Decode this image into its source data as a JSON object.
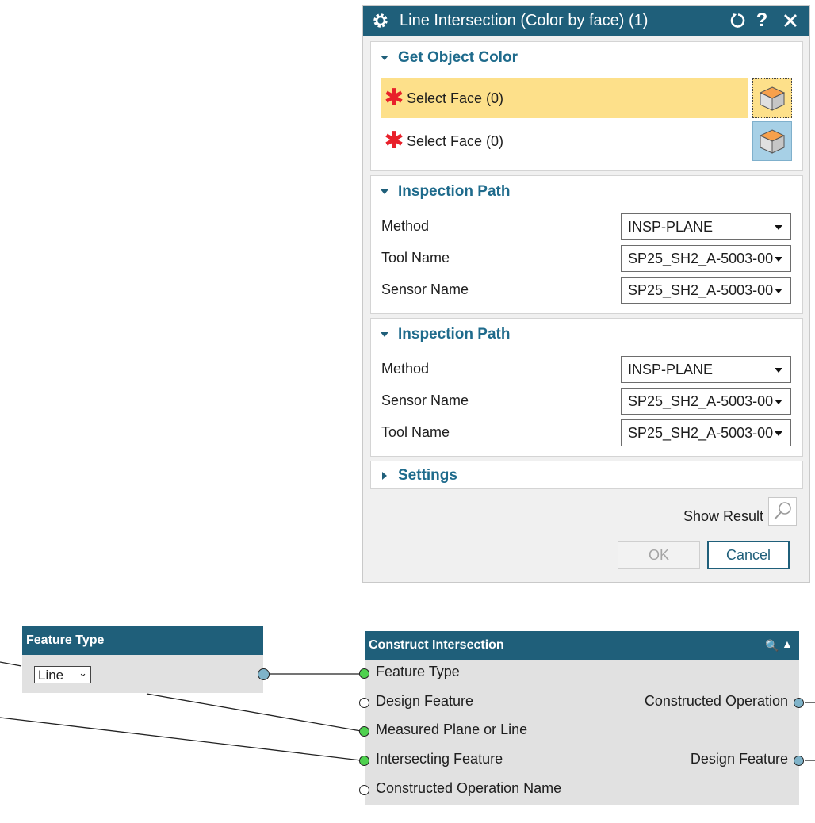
{
  "dialog": {
    "title": "Line Intersection (Color by face) (1)",
    "groups": {
      "object_color": {
        "title": "Get Object Color",
        "rows": [
          {
            "label": "Select Face (0)",
            "active": true
          },
          {
            "label": "Select Face (0)",
            "active": false
          }
        ]
      },
      "path1": {
        "title": "Inspection Path",
        "fields": [
          {
            "label": "Method",
            "value": "INSP-PLANE"
          },
          {
            "label": "Tool Name",
            "value": "SP25_SH2_A-5003-00"
          },
          {
            "label": "Sensor Name",
            "value": "SP25_SH2_A-5003-00"
          }
        ]
      },
      "path2": {
        "title": "Inspection Path",
        "fields": [
          {
            "label": "Method",
            "value": "INSP-PLANE"
          },
          {
            "label": "Sensor Name",
            "value": "SP25_SH2_A-5003-00"
          },
          {
            "label": "Tool Name",
            "value": "SP25_SH2_A-5003-00"
          }
        ]
      },
      "settings": {
        "title": "Settings"
      }
    },
    "show_result": "Show Result",
    "ok": "OK",
    "cancel": "Cancel"
  },
  "nodes": {
    "feature_type": {
      "title": "Feature Type",
      "select_value": "Line"
    },
    "construct": {
      "title": "Construct Intersection",
      "inputs": [
        "Feature Type",
        "Design Feature",
        "Measured Plane or Line",
        "Intersecting Feature",
        "Constructed Operation Name"
      ],
      "outputs": [
        "Constructed Operation",
        "Design Feature"
      ]
    }
  },
  "colors": {
    "accent": "#1f5f7a",
    "highlight": "#fde08a",
    "required_star": "#e8202a",
    "port_connected": "#4fd14f"
  }
}
